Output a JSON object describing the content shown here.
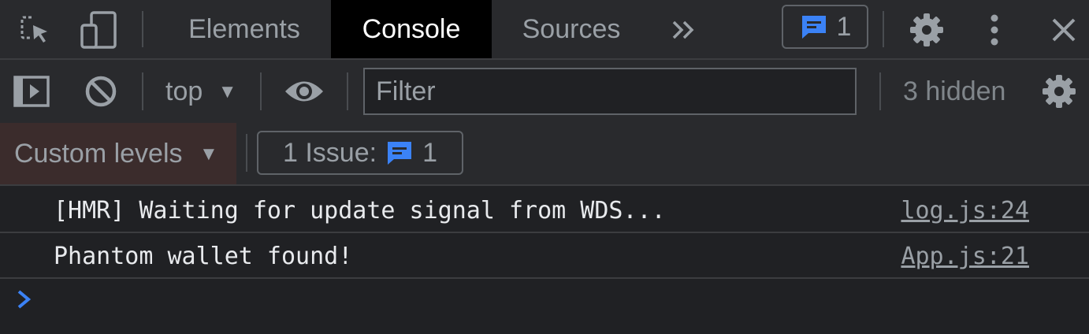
{
  "colors": {
    "accent": "#3b82f6",
    "panel": "#292a2d",
    "background": "#202124",
    "active_tab": "#000000"
  },
  "tabbar": {
    "icons": [
      "inspect-element-icon",
      "device-toolbar-icon",
      "more-tabs-chevron-icon",
      "message-icon",
      "gear-icon",
      "kebab-menu-icon",
      "close-icon"
    ],
    "tabs": [
      {
        "label": "Elements",
        "active": false
      },
      {
        "label": "Console",
        "active": true
      },
      {
        "label": "Sources",
        "active": false
      }
    ],
    "issue_count": "1"
  },
  "toolbar": {
    "context": "top",
    "filter_placeholder": "Filter",
    "filter_value": "",
    "hidden_text": "3 hidden"
  },
  "levels": {
    "label": "Custom levels",
    "issues_label": "1 Issue:",
    "issues_count": "1"
  },
  "messages": [
    {
      "text": "[HMR] Waiting for update signal from WDS...",
      "source": "log.js:24"
    },
    {
      "text": "Phantom wallet found!",
      "source": "App.js:21"
    }
  ]
}
